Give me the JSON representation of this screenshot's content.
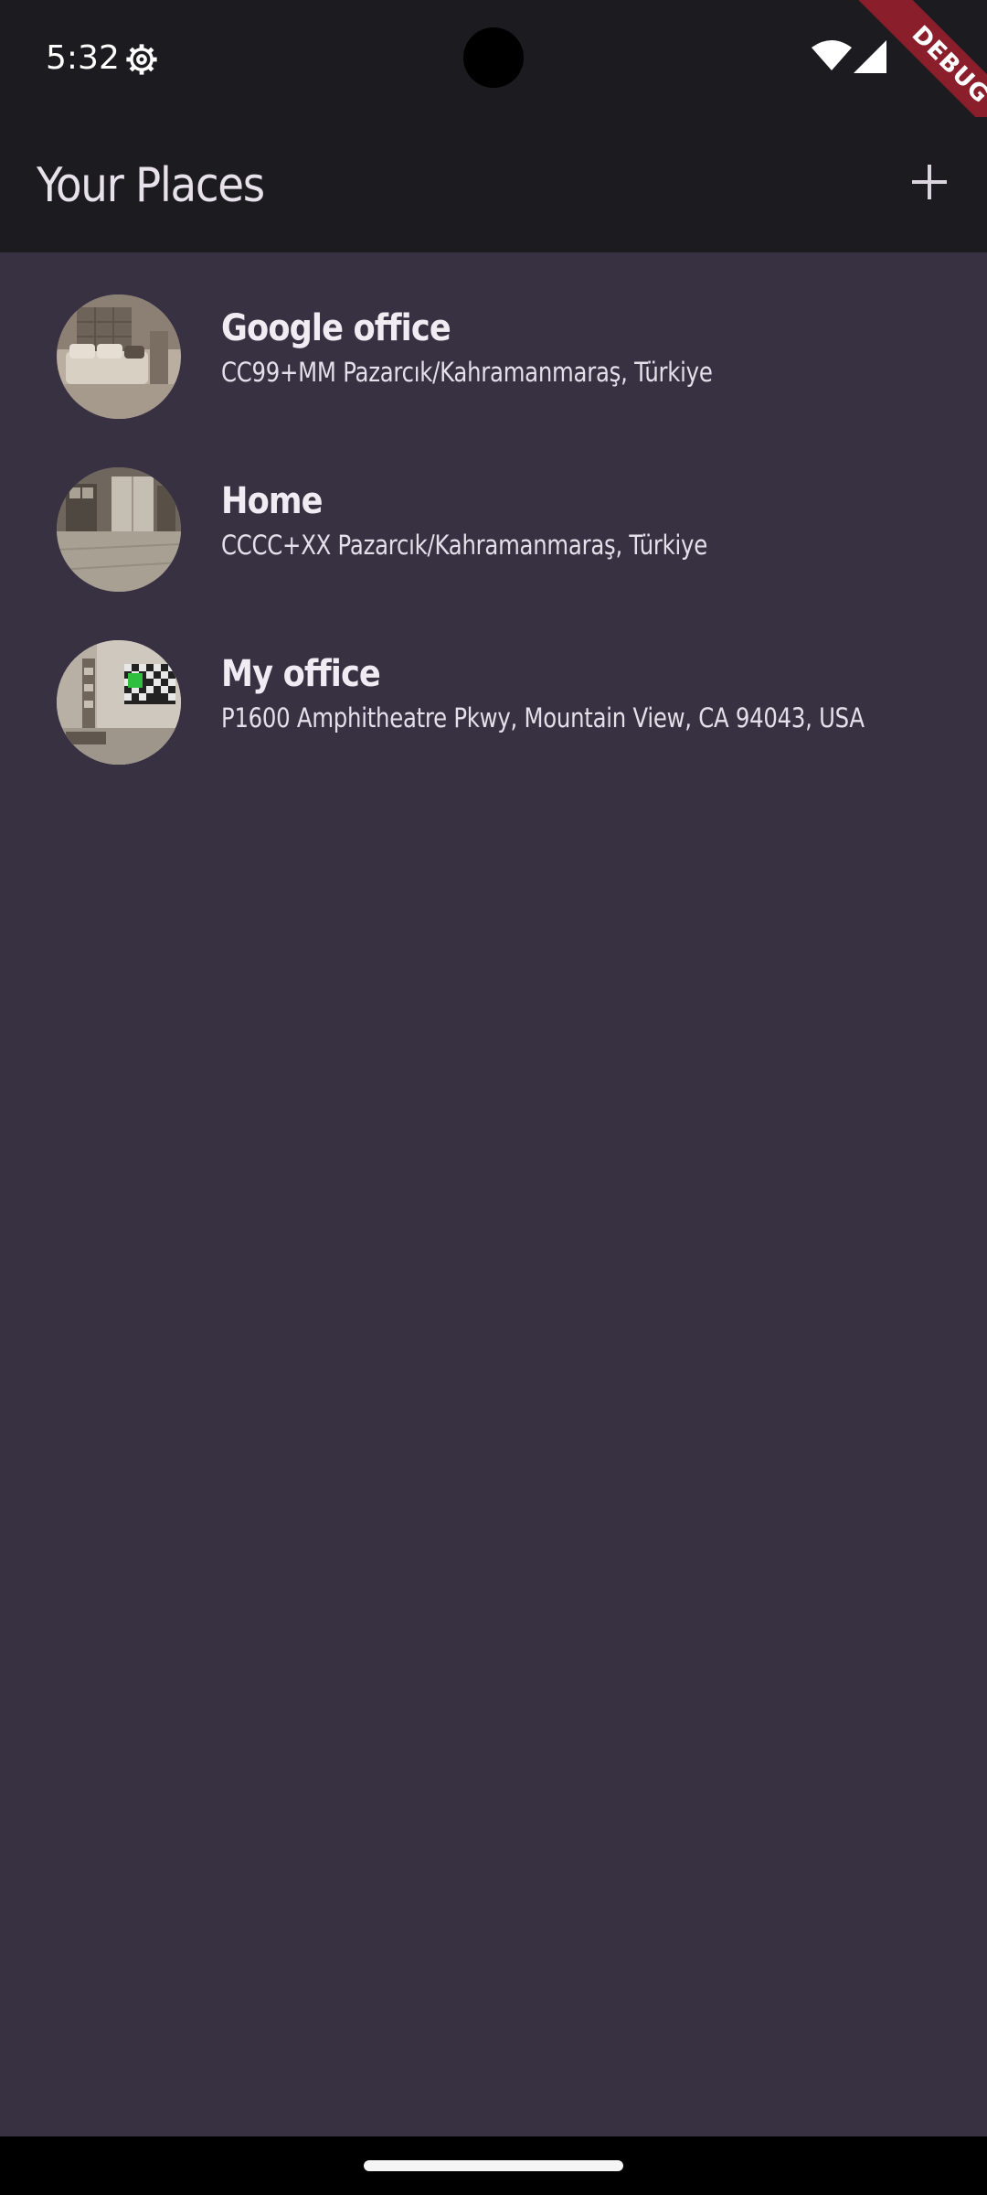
{
  "status_bar": {
    "time": "5:32",
    "icons": [
      "settings-icon",
      "wifi-icon",
      "cellular-signal-icon"
    ]
  },
  "debug_banner": {
    "label": "DEBUG",
    "color": "#8a1e2b"
  },
  "app_bar": {
    "title": "Your Places",
    "action_icon": "add-icon"
  },
  "places": [
    {
      "title": "Google office",
      "address": "CC99+MM Pazarcık/Kahramanmaraş, Türkiye",
      "thumbnail": "living-room-photo"
    },
    {
      "title": "Home",
      "address": "CCCC+XX Pazarcık/Kahramanmaraş, Türkiye",
      "thumbnail": "kitchen-photo"
    },
    {
      "title": "My office",
      "address": "P1600 Amphitheatre Pkwy, Mountain View, CA 94043, USA",
      "thumbnail": "room-with-tv-photo"
    }
  ],
  "colors": {
    "background": "#383142",
    "app_bar": "#1c1b1f",
    "title_text": "#e6e1ea"
  }
}
